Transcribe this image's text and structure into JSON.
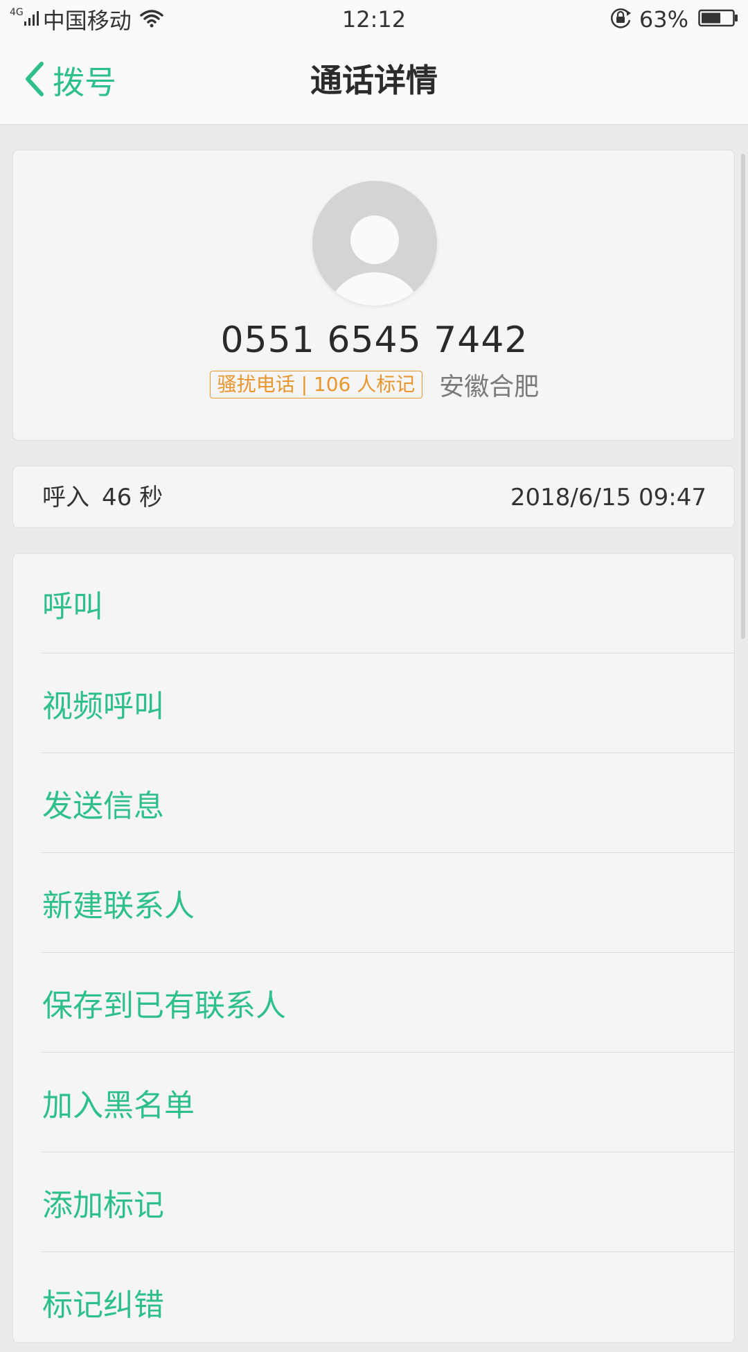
{
  "status_bar": {
    "network": "4G",
    "carrier": "中国移动",
    "time": "12:12",
    "battery_percent": "63%",
    "battery_level": 0.63,
    "icons": [
      "signal-icon",
      "wifi-icon",
      "rotation-lock-icon",
      "battery-icon"
    ]
  },
  "nav": {
    "back_label": "拨号",
    "title": "通话详情"
  },
  "contact": {
    "phone": "0551 6545 7442",
    "spam_tag": "骚扰电话 | 106 人标记",
    "location": "安徽合肥"
  },
  "call_record": {
    "direction": "呼入",
    "duration": "46 秒",
    "datetime": "2018/6/15 09:47"
  },
  "actions": [
    {
      "label": "呼叫"
    },
    {
      "label": "视频呼叫"
    },
    {
      "label": "发送信息"
    },
    {
      "label": "新建联系人"
    },
    {
      "label": "保存到已有联系人"
    },
    {
      "label": "加入黑名单"
    },
    {
      "label": "添加标记"
    },
    {
      "label": "标记纠错"
    }
  ],
  "colors": {
    "accent": "#2fbf8a",
    "warning": "#e8962d",
    "background": "#ebebeb",
    "card": "#f5f5f5"
  }
}
